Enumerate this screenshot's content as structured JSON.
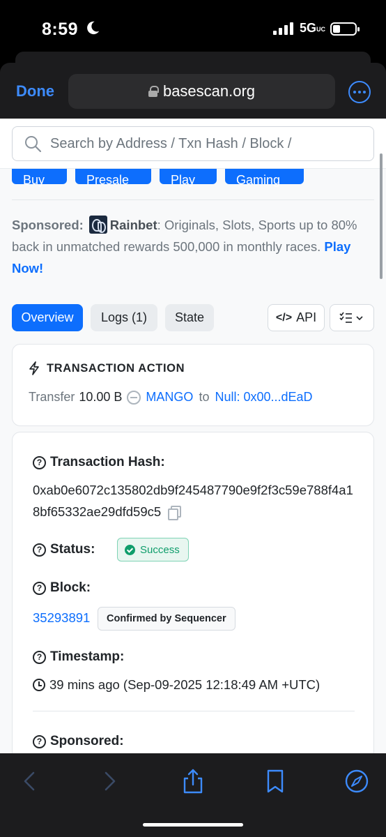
{
  "status_bar": {
    "time": "8:59",
    "network": "5G",
    "network_suffix": "UC"
  },
  "browser": {
    "done_label": "Done",
    "url": "basescan.org"
  },
  "search": {
    "placeholder": "Search by Address / Txn Hash / Block / Token / Domain Name"
  },
  "categories": [
    "Buy",
    "Presale",
    "Play",
    "Gaming"
  ],
  "sponsored": {
    "label": "Sponsored:",
    "brand": "Rainbet",
    "text": ": Originals, Slots, Sports up to 80% back in unmatched rewards 500,000 in monthly races.",
    "cta": "Play Now!"
  },
  "tabs": [
    {
      "label": "Overview",
      "active": true
    },
    {
      "label": "Logs (1)",
      "active": false
    },
    {
      "label": "State",
      "active": false
    }
  ],
  "tab_actions": {
    "api_label": "API",
    "api_icon": "</>"
  },
  "transaction_action": {
    "heading": "TRANSACTION ACTION",
    "verb": "Transfer",
    "amount": "10.00 B",
    "token": "MANGO",
    "to_word": "to",
    "recipient": "Null: 0x00...dEaD"
  },
  "details": {
    "hash_label": "Transaction Hash:",
    "hash": "0xab0e6072c135802db9f245487790e9f2f3c59e788f4a18bf65332ae29dfd59c5",
    "status_label": "Status:",
    "status": "Success",
    "block_label": "Block:",
    "block": "35293891",
    "block_badge": "Confirmed by Sequencer",
    "timestamp_label": "Timestamp:",
    "timestamp": "39 mins ago (Sep-09-2025 12:18:49 AM +UTC)",
    "sponsored_label": "Sponsored:"
  },
  "colors": {
    "accent": "#0d6efd",
    "success": "#0f9d6b",
    "safari_blue": "#3d8bfd"
  }
}
